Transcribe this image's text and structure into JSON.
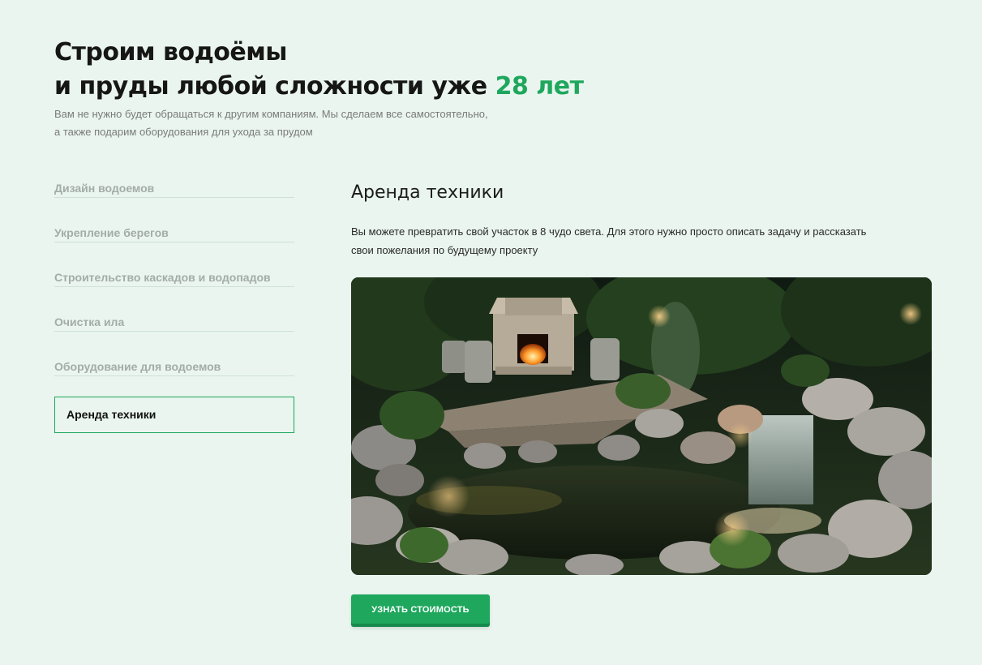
{
  "header": {
    "title_line1": "Строим водоёмы",
    "title_line2": "и пруды любой сложности уже ",
    "title_accent": "28 лет",
    "subtitle_line1": "Вам не нужно будет обращаться к другим компаниям. Мы сделаем все самостоятельно,",
    "subtitle_line2": "а также подарим оборудования для ухода за прудом"
  },
  "tabs": [
    {
      "label": "Дизайн водоемов",
      "active": false
    },
    {
      "label": "Укрепление берегов",
      "active": false
    },
    {
      "label": "Строительство каскадов и водопадов",
      "active": false
    },
    {
      "label": "Очистка ила",
      "active": false
    },
    {
      "label": "Оборудование для водоемов",
      "active": false
    },
    {
      "label": "Аренда техники",
      "active": true
    }
  ],
  "content": {
    "title": "Аренда техники",
    "text_line1": "Вы можете превратить свой участок в 8 чудо света. Для этого нужно просто описать задачу и рассказать",
    "text_line2": "свои пожелания по будущему проекту",
    "image": "garden-pond-waterfall-fireplace-photo"
  },
  "cta": {
    "label": "УЗНАТЬ СТОИМОСТЬ"
  },
  "colors": {
    "background": "#e9f5ee",
    "accent": "#1ea75d",
    "tab_inactive": "#a4aca7",
    "tab_border": "#cfe1d6"
  }
}
